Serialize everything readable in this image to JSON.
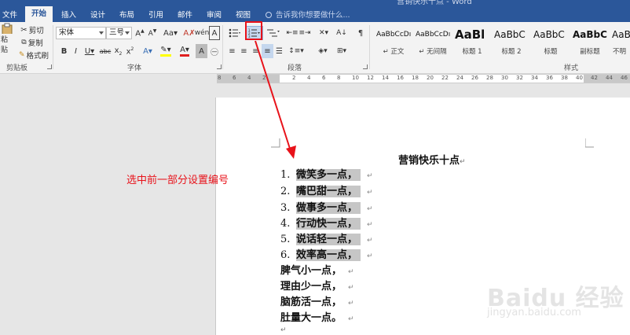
{
  "window": {
    "doc_title": "营销快乐十点 - Word"
  },
  "tabs": [
    {
      "label": "文件"
    },
    {
      "label": "开始"
    },
    {
      "label": "插入"
    },
    {
      "label": "设计"
    },
    {
      "label": "布局"
    },
    {
      "label": "引用"
    },
    {
      "label": "邮件"
    },
    {
      "label": "审阅"
    },
    {
      "label": "视图"
    }
  ],
  "tell_me": {
    "placeholder": "告诉我你想要做什么..."
  },
  "clipboard": {
    "paste_label": "粘贴",
    "cut_label": "剪切",
    "copy_label": "复制",
    "format_painter_label": "格式刷",
    "group_label": "剪贴板"
  },
  "font": {
    "family": "宋体",
    "size": "三号",
    "group_label": "字体"
  },
  "paragraph": {
    "group_label": "段落"
  },
  "styles": {
    "group_label": "样式",
    "items": [
      {
        "sample": "AaBbCcDı",
        "name": "↵ 正文"
      },
      {
        "sample": "AaBbCcDı",
        "name": "↵ 无间隔"
      },
      {
        "sample": "AaBl",
        "name": "标题 1"
      },
      {
        "sample": "AaBbC",
        "name": "标题 2"
      },
      {
        "sample": "AaBbC",
        "name": "标题"
      },
      {
        "sample": "AaBbC",
        "name": "副标题"
      },
      {
        "sample": "AaBbC",
        "name": "不明"
      }
    ]
  },
  "ruler": {
    "numbers": [
      "8",
      "6",
      "4",
      "2",
      "",
      "2",
      "4",
      "6",
      "8",
      "10",
      "12",
      "14",
      "16",
      "18",
      "20",
      "22",
      "24",
      "26",
      "28",
      "30",
      "32",
      "34",
      "36",
      "38",
      "40",
      "42",
      "44",
      "46"
    ]
  },
  "document": {
    "title": "营销快乐十点",
    "numbered_items": [
      {
        "num": "1.",
        "text": "微笑多一点，"
      },
      {
        "num": "2.",
        "text": "嘴巴甜一点，"
      },
      {
        "num": "3.",
        "text": "做事多一点，"
      },
      {
        "num": "4.",
        "text": "行动快一点，"
      },
      {
        "num": "5.",
        "text": "说话轻一点，"
      },
      {
        "num": "6.",
        "text": "效率高一点，"
      }
    ],
    "plain_items": [
      {
        "text": "脾气小一点，"
      },
      {
        "text": "理由少一点，"
      },
      {
        "text": "脑筋活一点，"
      },
      {
        "text": "肚量大一点。"
      }
    ],
    "para_mark": "↵"
  },
  "annotation": {
    "text": "选中前一部分设置编号"
  },
  "watermark": {
    "main": "Baidu 经验",
    "sub": "jingyan.baidu.com"
  },
  "colors": {
    "ribbon_blue": "#2b579a",
    "annotation_red": "#e8121a",
    "highlight_gray": "#c6c6c6"
  }
}
